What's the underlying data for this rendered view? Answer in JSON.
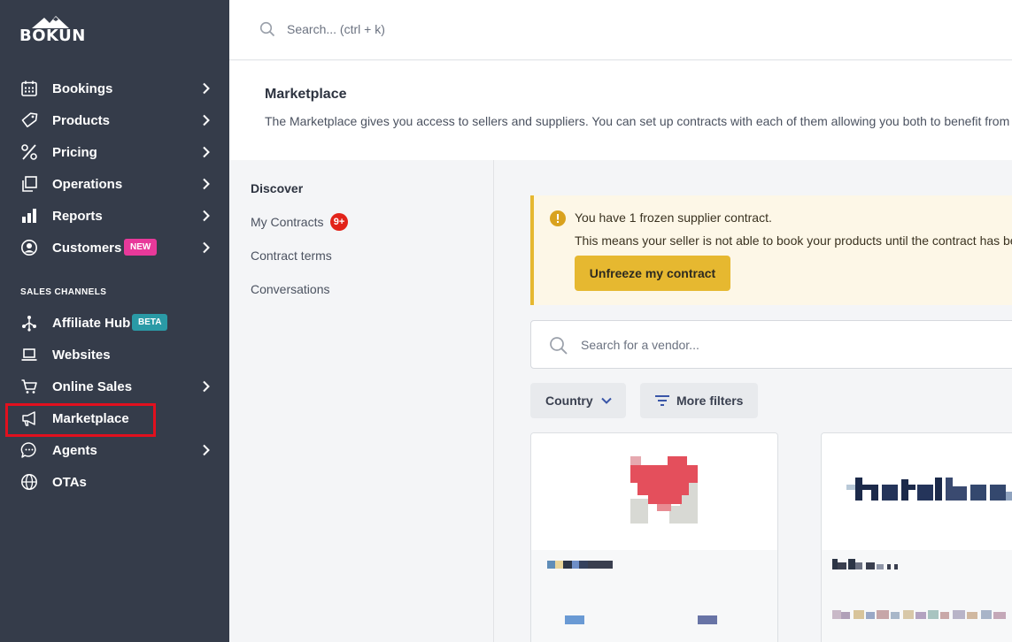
{
  "sidebar": {
    "logo_text": "BÓKUN",
    "main_items": [
      {
        "label": "Bookings"
      },
      {
        "label": "Products"
      },
      {
        "label": "Pricing"
      },
      {
        "label": "Operations"
      },
      {
        "label": "Reports"
      },
      {
        "label": "Customers",
        "badge": "NEW"
      }
    ],
    "section_title": "SALES CHANNELS",
    "channel_items": [
      {
        "label": "Affiliate Hub",
        "badge": "BETA"
      },
      {
        "label": "Websites"
      },
      {
        "label": "Online Sales"
      },
      {
        "label": "Marketplace"
      },
      {
        "label": "Agents"
      },
      {
        "label": "OTAs"
      }
    ]
  },
  "topbar": {
    "search_placeholder": "Search... (ctrl + k)"
  },
  "header": {
    "title": "Marketplace",
    "description": "The Marketplace gives you access to sellers and suppliers. You can set up contracts with each of them allowing you both to benefit from"
  },
  "subnav": {
    "items": [
      "Discover",
      "My Contracts",
      "Contract terms",
      "Conversations"
    ],
    "contracts_count": "9+"
  },
  "alert": {
    "line1": "You have 1 frozen supplier contract.",
    "line2": "This means your seller is not able to book your products until the contract has be",
    "button": "Unfreeze my contract"
  },
  "vendor_search": {
    "placeholder": "Search for a vendor..."
  },
  "filters": {
    "country": "Country",
    "more": "More filters"
  },
  "colors": {
    "sidebar_bg": "#353c4a",
    "new_badge": "#e8399a",
    "beta_badge": "#2a9aa6",
    "highlight": "#e2101e",
    "alert_accent": "#e6b830",
    "count_badge": "#e2231a"
  }
}
